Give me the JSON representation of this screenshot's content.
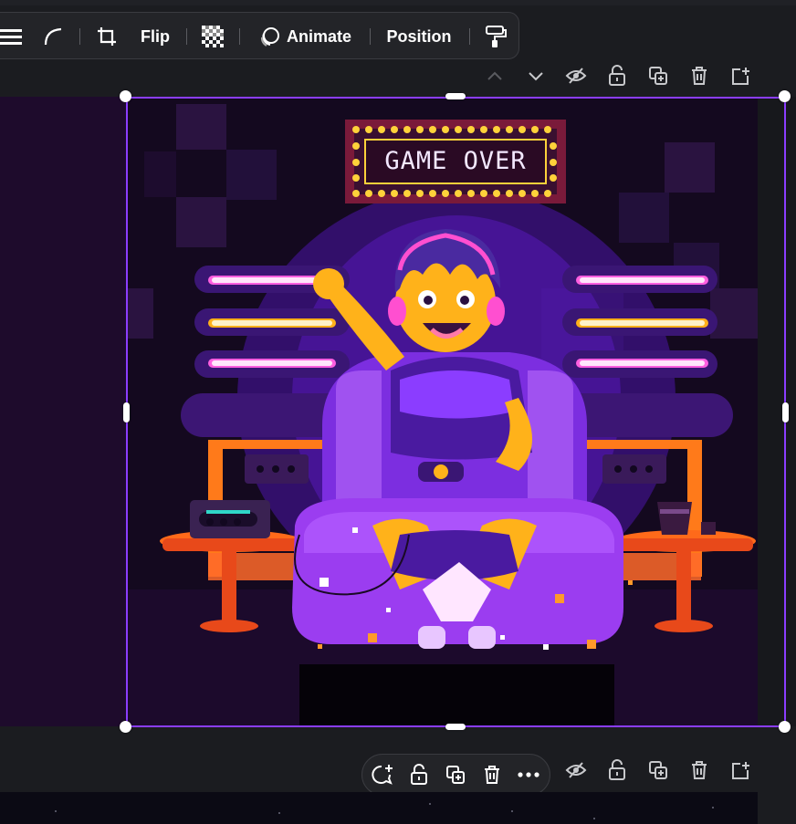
{
  "toolbar": {
    "flip_label": "Flip",
    "animate_label": "Animate",
    "position_label": "Position"
  },
  "artwork": {
    "sign_text": "GAME OVER",
    "colors": {
      "background": "#14091f",
      "purple": "#6a1fd0",
      "orange": "#ff7a1a",
      "yellow": "#ffc21a",
      "pink_neon": "#ff5fe0",
      "selection": "#8b3dff"
    }
  },
  "page_controls": {
    "icons": [
      "chevron-up-icon",
      "chevron-down-icon",
      "hide-icon",
      "lock-icon",
      "duplicate-icon",
      "trash-icon",
      "add-page-icon"
    ]
  },
  "context_menu": {
    "icons": [
      "comment-add-icon",
      "lock-icon",
      "duplicate-icon",
      "trash-icon",
      "more-icon"
    ]
  }
}
